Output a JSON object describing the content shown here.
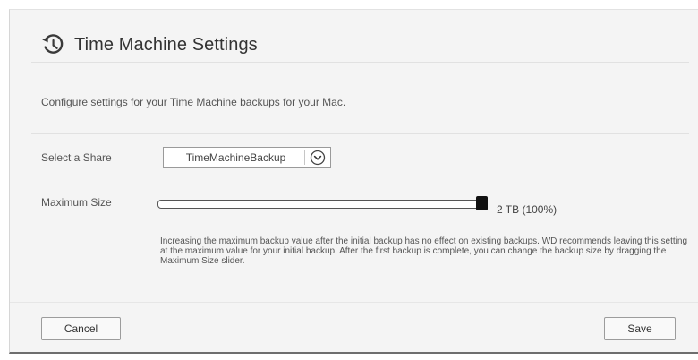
{
  "header": {
    "title": "Time Machine Settings",
    "icon": "history-clock-icon"
  },
  "intro": "Configure settings for your Time Machine backups for your Mac.",
  "share": {
    "label": "Select a Share",
    "selected": "TimeMachineBackup",
    "icon": "chevron-down-circle-icon"
  },
  "max_size": {
    "label": "Maximum Size",
    "value_text": "2 TB (100%)",
    "fraction": 1.0,
    "help": "Increasing the maximum backup value after the initial backup has no effect on existing backups. WD recommends leaving this setting at the maximum value for your initial backup. After the first backup is complete, you can change the backup size by dragging the Maximum Size slider."
  },
  "buttons": {
    "cancel": "Cancel",
    "save": "Save"
  }
}
